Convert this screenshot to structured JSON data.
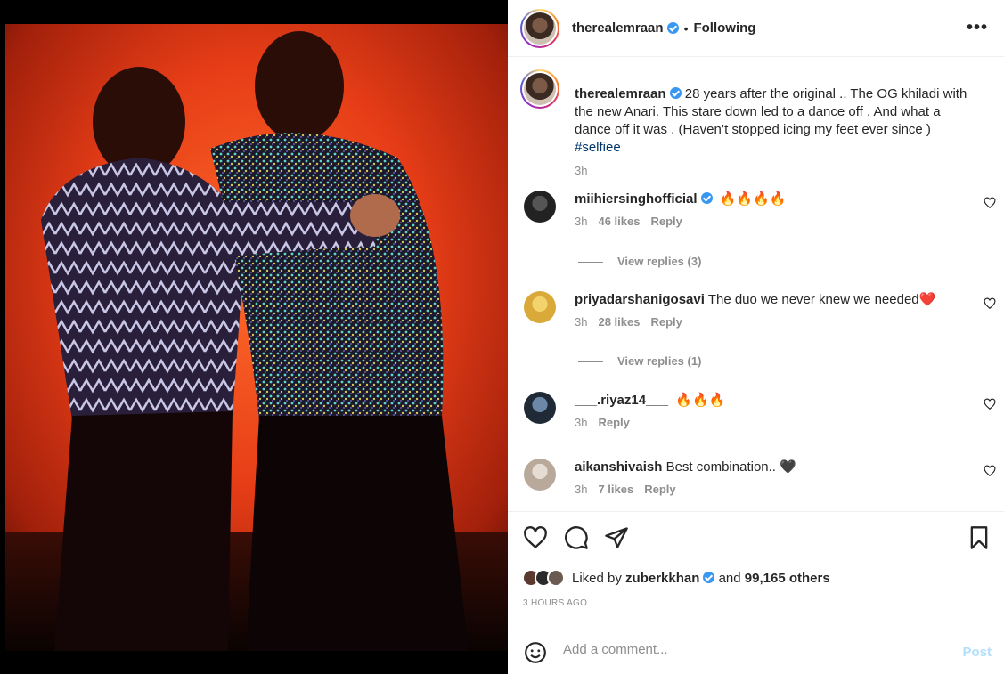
{
  "post": {
    "username": "therealemraan",
    "separator": "•",
    "following_label": "Following",
    "more_label": "•••"
  },
  "caption": {
    "username": "therealemraan",
    "text": "28 years after the original .. The OG khiladi with the new Anari. This stare down led to a dance off . And what a dance off it was . (Haven’t stopped icing my feet ever since )",
    "hashtag": "#selfiee",
    "time": "3h"
  },
  "comments": [
    {
      "username": "miihiersinghofficial",
      "verified": true,
      "text": "🔥🔥🔥🔥",
      "time": "3h",
      "likes": "46 likes",
      "reply": "Reply",
      "view_replies": "View replies (3)"
    },
    {
      "username": "priyadarshanigosavi",
      "verified": false,
      "text": "The duo we never knew we needed❤️",
      "time": "3h",
      "likes": "28 likes",
      "reply": "Reply",
      "view_replies": "View replies (1)"
    },
    {
      "username": "___.riyaz14___",
      "verified": false,
      "text": "🔥🔥🔥",
      "time": "3h",
      "likes": "",
      "reply": "Reply",
      "view_replies": ""
    },
    {
      "username": "aikanshivaish",
      "verified": false,
      "text": "Best combination.. 🖤",
      "time": "3h",
      "likes": "7 likes",
      "reply": "Reply",
      "view_replies": ""
    }
  ],
  "likes": {
    "liked_by_prefix": "Liked by",
    "liked_by_user": "zuberkkhan",
    "and_label": "and",
    "others": "99,165 others"
  },
  "posted_ago": "3 HOURS AGO",
  "composer": {
    "placeholder": "Add a comment...",
    "post_label": "Post"
  },
  "icons": {
    "like": "heart-icon",
    "comment": "comment-icon",
    "share": "send-icon",
    "save": "bookmark-icon",
    "emoji": "smile-icon",
    "more": "more-icon"
  },
  "colors": {
    "verified": "#3897f0",
    "link": "#00376b",
    "secondary_text": "#8e8e8e",
    "post_button_disabled": "#b2dffc",
    "heart_red": "#e0245e"
  }
}
